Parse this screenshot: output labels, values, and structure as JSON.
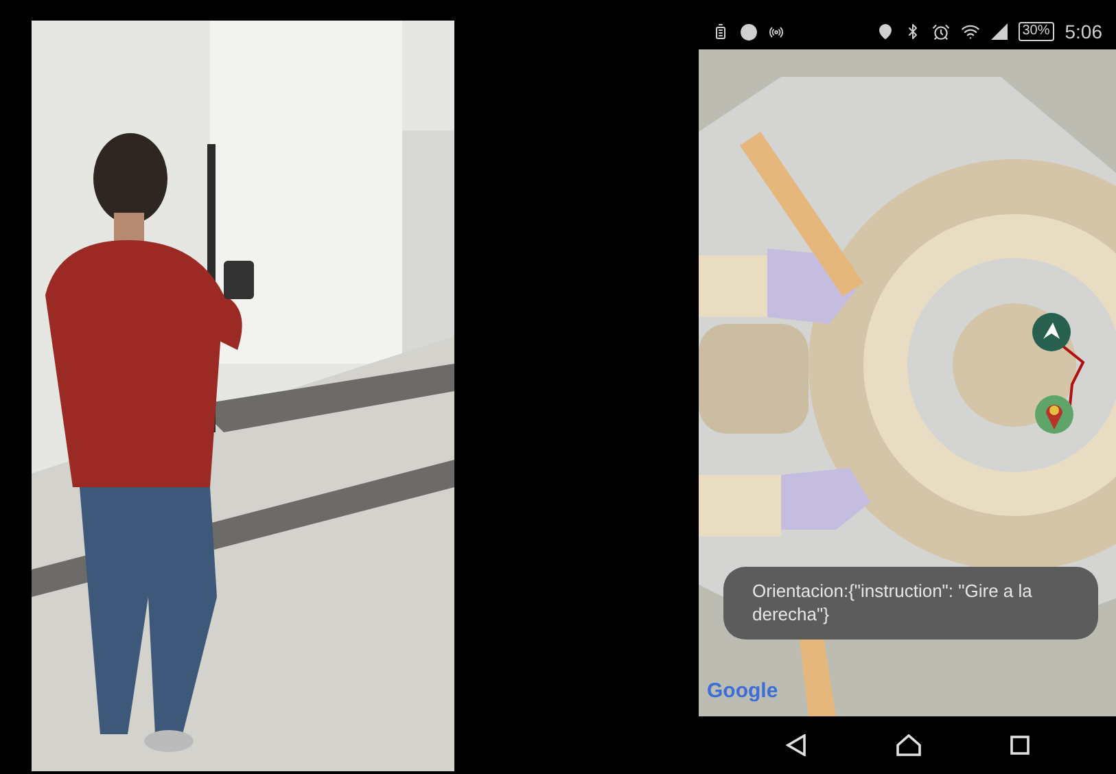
{
  "phone": {
    "status_bar": {
      "battery": "30%",
      "time": "5:06"
    },
    "map": {
      "kind": "picture",
      "attribution": "Google"
    },
    "toast": {
      "text": "Orientacion:{\"instruction\": \"Gire a la derecha\"}"
    }
  }
}
